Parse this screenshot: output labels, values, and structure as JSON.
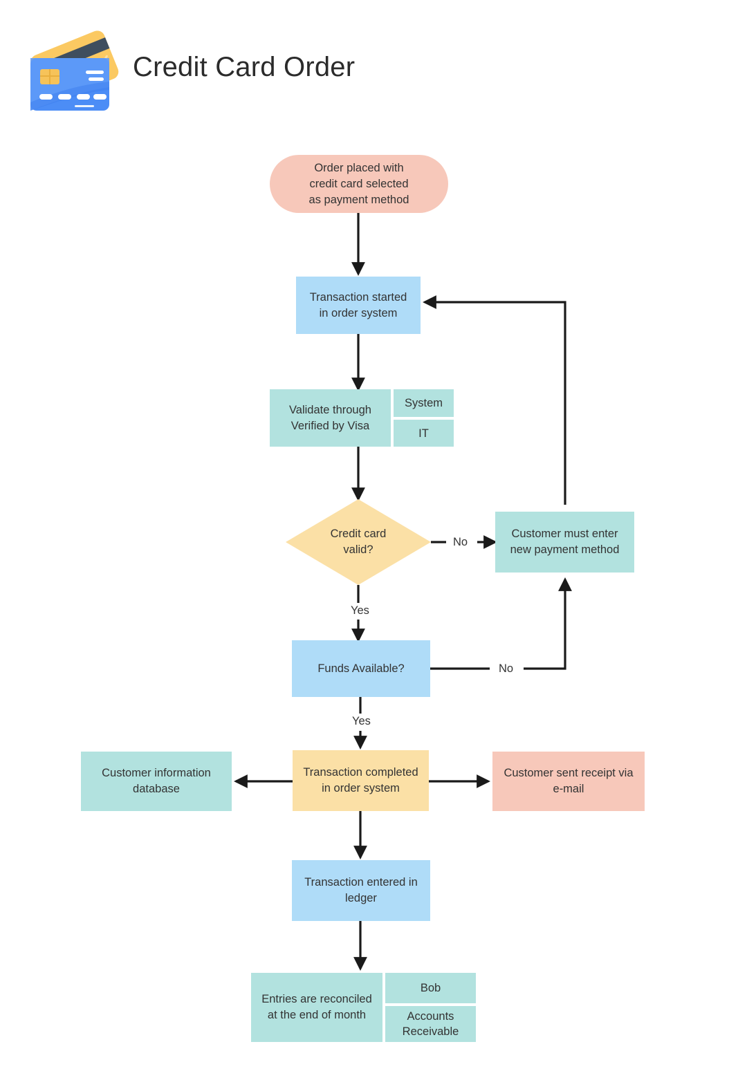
{
  "header": {
    "title": "Credit Card Order",
    "icon": "credit-card-icon"
  },
  "colors": {
    "pink": "#F7C8BA",
    "blue": "#AFDCF8",
    "teal": "#B2E2DF",
    "yellow": "#FBE0A6",
    "line": "#1a1a1a",
    "text": "#333333",
    "background": "#FFFFFF"
  },
  "chart_data": {
    "type": "diagram",
    "title": "Credit Card Order",
    "nodes": [
      {
        "id": "start",
        "label": "Order placed with credit card selected as payment method",
        "shape": "terminator",
        "color": "#F7C8BA"
      },
      {
        "id": "txn_started",
        "label": "Transaction started in order system",
        "shape": "process",
        "color": "#AFDCF8"
      },
      {
        "id": "validate",
        "label": "Validate through Verified by Visa",
        "shape": "process-split",
        "color": "#B2E2DF",
        "side": [
          "System",
          "IT"
        ]
      },
      {
        "id": "card_valid",
        "label": "Credit card valid?",
        "shape": "decision",
        "color": "#FBE0A6"
      },
      {
        "id": "new_payment",
        "label": "Customer must enter new payment method",
        "shape": "process",
        "color": "#B2E2DF"
      },
      {
        "id": "funds",
        "label": "Funds Available?",
        "shape": "process",
        "color": "#AFDCF8"
      },
      {
        "id": "cust_db",
        "label": "Customer information database",
        "shape": "process",
        "color": "#B2E2DF"
      },
      {
        "id": "txn_complete",
        "label": "Transaction completed in order system",
        "shape": "process",
        "color": "#FBE0A6"
      },
      {
        "id": "receipt",
        "label": "Customer sent receipt via e-mail",
        "shape": "process",
        "color": "#F7C8BA"
      },
      {
        "id": "ledger",
        "label": "Transaction entered in ledger",
        "shape": "process",
        "color": "#AFDCF8"
      },
      {
        "id": "reconcile",
        "label": "Entries are reconciled at the end of month",
        "shape": "process-split",
        "color": "#B2E2DF",
        "side": [
          "Bob",
          "Accounts Receivable"
        ]
      }
    ],
    "edges": [
      {
        "from": "start",
        "to": "txn_started",
        "label": ""
      },
      {
        "from": "txn_started",
        "to": "validate",
        "label": ""
      },
      {
        "from": "validate",
        "to": "card_valid",
        "label": ""
      },
      {
        "from": "card_valid",
        "to": "new_payment",
        "label": "No"
      },
      {
        "from": "card_valid",
        "to": "funds",
        "label": "Yes"
      },
      {
        "from": "new_payment",
        "to": "txn_started",
        "label": ""
      },
      {
        "from": "funds",
        "to": "new_payment",
        "label": "No"
      },
      {
        "from": "funds",
        "to": "txn_complete",
        "label": "Yes"
      },
      {
        "from": "txn_complete",
        "to": "cust_db",
        "label": ""
      },
      {
        "from": "txn_complete",
        "to": "receipt",
        "label": ""
      },
      {
        "from": "txn_complete",
        "to": "ledger",
        "label": ""
      },
      {
        "from": "ledger",
        "to": "reconcile",
        "label": ""
      }
    ]
  },
  "nodes": {
    "start": {
      "line1": "Order placed with",
      "line2": "credit card selected",
      "line3": "as payment method"
    },
    "txn_started": {
      "line1": "Transaction started",
      "line2": "in order system"
    },
    "validate": {
      "line1": "Validate through",
      "line2": "Verified by Visa",
      "side1": "System",
      "side2": "IT"
    },
    "card_valid": {
      "line1": "Credit card",
      "line2": "valid?"
    },
    "new_payment": {
      "line1": "Customer must enter",
      "line2": "new payment method"
    },
    "funds": {
      "line1": "Funds Available?"
    },
    "cust_db": {
      "line1": "Customer information",
      "line2": "database"
    },
    "txn_complete": {
      "line1": "Transaction completed",
      "line2": "in order system"
    },
    "receipt": {
      "line1": "Customer sent receipt via",
      "line2": "e-mail"
    },
    "ledger": {
      "line1": "Transaction entered in",
      "line2": "ledger"
    },
    "reconcile": {
      "line1": "Entries are reconciled",
      "line2": "at the end of month",
      "side1": "Bob",
      "side2a": "Accounts",
      "side2b": "Receivable"
    }
  },
  "edge_labels": {
    "card_valid_no": "No",
    "card_valid_yes": "Yes",
    "funds_no": "No",
    "funds_yes": "Yes"
  }
}
